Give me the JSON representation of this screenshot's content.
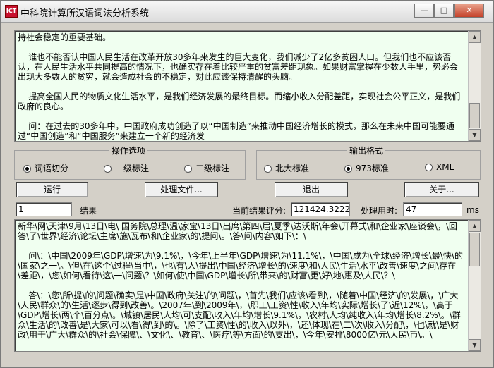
{
  "window": {
    "title": "中科院计算所汉语词法分析系统",
    "icon_text": "ICT"
  },
  "input_text": "持社会稳定的重要基础。\n\n    谁也不能否认中国人民生活在改革开放30多年来发生的巨大变化，我们减少了2亿多贫困人口。但我们也不应该否认，在人民生活水平共同提高的情况下，也确实存在着比较严重的贫富差距现象。如果财富掌握在少数人手里，势必会出现大多数人的贫穷，就会造成社会的不稳定，对此应该保持清醒的头脑。\n\n    提高全国人民的物质文化生活水平，是我们经济发展的最终目标。而缩小收入分配差距，实现社会公平正义，是我们政府的良心。\n\n    问：在过去的30多年中，中国政府成功创造了以“中国制造”来推动中国经济增长的模式，那么在未来中国可能要通过“中国创造”和“中国服务”来建立一个新的经济发",
  "operations": {
    "title": "操作选项",
    "options": [
      "词语切分",
      "一级标注",
      "二级标注"
    ],
    "selected": 0
  },
  "output_format": {
    "title": "输出格式",
    "options": [
      "北大标准",
      "973标准",
      "XML"
    ],
    "selected": 1
  },
  "buttons": {
    "run": "运行",
    "process_file": "处理文件...",
    "exit": "退出",
    "about": "关于..."
  },
  "status": {
    "result_index": "1",
    "result_label": "结果",
    "score_label": "当前结果评分:",
    "score_value": "121424.3222",
    "time_label": "处理用时:",
    "time_value": "47",
    "time_unit": "ms"
  },
  "output_text": "新华\\网\\天津\\9月\\13日\\电\\ 国务院\\总理\\温\\家宝\\13日\\出席\\第四\\届\\夏季\\达沃斯\\年会\\开幕式\\和\\企业家\\座谈会\\，\\回答\\了\\世界\\经济\\论坛\\主席\\施\\瓦布\\和\\企业家\\的\\提问\\。\\答\\问\\内容\\如下\\：\\\n\n    问\\：\\中国\\2009年\\GDP\\增速\\为\\9.1%\\，\\今年\\上半年\\GDP\\增速\\为\\11.1%\\，\\中国\\成为\\全球\\经济\\增长\\最\\快\\的\\国家\\之一\\。\\但\\在\\这个\\过程\\当中\\，\\也\\有\\人\\提出\\中国\\经济\\增长\\的\\速度\\和\\人民\\生活\\水平\\改善\\速度\\之间\\存在\\差距\\，\\您\\如何\\看待\\这\\一\\问题\\？\\如何\\使\\中国\\GDP\\增长\\所\\带来\\的\\财富\\更\\好\\地\\惠及\\人民\\？\\\n\n    答\\：\\您\\所\\提\\的\\问题\\确实\\是\\中国\\政府\\关注\\的\\问题\\，\\首先\\我们\\应该\\看到\\，\\随着\\中国\\经济\\的\\发展\\，\\广大\\人民\\群众\\的\\生活\\逐步\\得到\\改善\\。\\2007年\\到\\2009年\\，\\职工\\工资\\性\\收入\\年均\\实际\\增长\\了\\近\\12%\\，\\高于\\GDP\\增长\\两\\个\\百分点\\。\\城镇\\居民\\人均\\可\\支配\\收入\\年均\\增长\\9.1%\\，\\农村\\人均\\纯收入\\年均\\增长\\8.2%\\。\\群众\\生活\\的\\改善\\是\\大家\\可以\\看\\得\\到\\的\\。\\除了\\工资\\性\\的\\收入\\以外\\，\\还\\体现\\在\\二\\次\\收入\\分配\\，\\也\\就\\是\\财政\\用于\\广大\\群众\\的\\社会\\保障\\、\\文化\\、\\教育\\、\\医疗\\等\\方面\\的\\支出\\，\\今年\\安排\\8000亿\\元\\人民\\币\\。\\",
  "colors": {
    "text_background": "#f0fff0",
    "window_background": "#d4d0c8"
  },
  "icons": [
    "minimize-icon",
    "maximize-icon",
    "close-icon",
    "scroll-up-icon",
    "scroll-down-icon"
  ]
}
